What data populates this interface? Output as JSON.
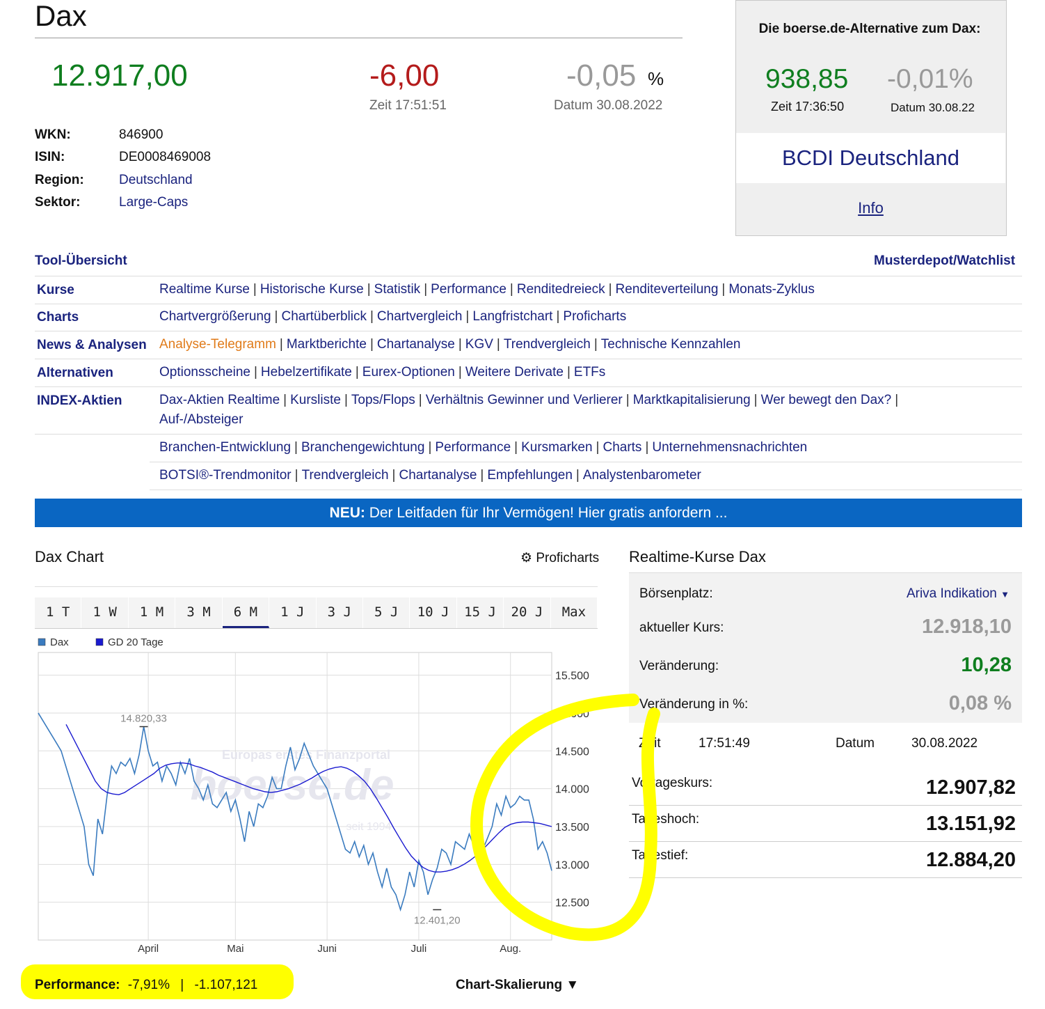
{
  "header": {
    "title": "Dax",
    "price": "12.917,00",
    "change": "-6,00",
    "change_pct": "-0,05",
    "pct_sign": "%",
    "time": "Zeit 17:51:51",
    "date": "Datum 30.08.2022"
  },
  "details": [
    {
      "label": "WKN:",
      "value": "846900"
    },
    {
      "label": "ISIN:",
      "value": "DE0008469008"
    },
    {
      "label": "Region:",
      "value": "Deutschland"
    },
    {
      "label": "Sektor:",
      "value": "Large-Caps"
    }
  ],
  "alt_box": {
    "heading": "Die boerse.de-Alternative zum Dax:",
    "price": "938,85",
    "change_pct": "-0,01%",
    "time": "Zeit 17:36:50",
    "date": "Datum 30.08.22",
    "product": "BCDI Deutschland",
    "info_link": "Info"
  },
  "tools": {
    "heading": "Tool-Übersicht",
    "watchlist": "Musterdepot/Watchlist",
    "rows": [
      {
        "cat": "Kurse",
        "links": [
          "Realtime Kurse",
          "Historische Kurse",
          "Statistik",
          "Performance",
          "Renditedreieck",
          "Renditeverteilung",
          "Monats-Zyklus"
        ]
      },
      {
        "cat": "Charts",
        "links": [
          "Chartvergrößerung",
          "Chartüberblick",
          "Chartvergleich",
          "Langfristchart",
          "Proficharts"
        ]
      },
      {
        "cat": "News & Analysen",
        "links": [
          "Analyse-Telegramm",
          "Marktberichte",
          "Chartanalyse",
          "KGV",
          "Trendvergleich",
          "Technische Kennzahlen"
        ]
      },
      {
        "cat": "Alternativen",
        "links": [
          "Optionsscheine",
          "Hebelzertifikate",
          "Eurex-Optionen",
          "Weitere Derivate",
          "ETFs"
        ]
      },
      {
        "cat": "INDEX-Aktien",
        "links": [
          "Dax-Aktien Realtime",
          "Kursliste",
          "Tops/Flops",
          "Verhältnis Gewinner und Verlierer",
          "Marktkapitalisierung",
          "Wer bewegt den Dax?",
          "Auf-/Absteiger"
        ]
      },
      {
        "cat": "",
        "links": [
          "Branchen-Entwicklung",
          "Branchengewichtung",
          "Performance",
          "Kursmarken",
          "Charts",
          "Unternehmensnachrichten"
        ]
      },
      {
        "cat": "",
        "links": [
          "BOTSI®-Trendmonitor",
          "Trendvergleich",
          "Chartanalyse",
          "Empfehlungen",
          "Analystenbarometer"
        ]
      }
    ]
  },
  "banner": {
    "bold": "NEU:",
    "text": " Der Leitfaden für Ihr Vermögen! Hier gratis anfordern ..."
  },
  "chart_section": {
    "title": "Dax Chart",
    "proficharts": "Proficharts",
    "tabs": [
      "1 T",
      "1 W",
      "1 M",
      "3 M",
      "6 M",
      "1 J",
      "3 J",
      "5 J",
      "10 J",
      "15 J",
      "20 J",
      "Max"
    ],
    "active_tab": "6 M",
    "watermark": "boerse.de",
    "watermark_top": "Europas erstes Finanzportal",
    "watermark_bottom": "seit 1994",
    "performance_label": "Performance:",
    "performance_value": "-7,91%",
    "performance_sep": "|",
    "performance_abs": "-1.107,121",
    "scaling": "Chart-Skalierung ▼"
  },
  "chart_data": {
    "type": "line",
    "legend": [
      {
        "name": "Dax",
        "color": "#3a7bbf"
      },
      {
        "name": "GD 20 Tage",
        "color": "#1a1ad0"
      }
    ],
    "ylim": [
      12000,
      15800
    ],
    "yticks": [
      12500,
      13000,
      13500,
      14000,
      14500,
      15000,
      15500
    ],
    "ytick_labels": [
      "12.500",
      "13.000",
      "13.500",
      "14.000",
      "14.500",
      "15.000",
      "15.500"
    ],
    "xtick_labels": [
      "April",
      "Mai",
      "Juni",
      "Juli",
      "Aug."
    ],
    "xticks_idx": [
      26,
      46,
      68,
      89,
      110
    ],
    "annotations": [
      {
        "label": "14.820,33",
        "index": 23,
        "value": 14820
      },
      {
        "label": "12.401,20",
        "index": 87,
        "value": 12401
      }
    ],
    "series": [
      {
        "name": "Dax",
        "values": [
          15000,
          14900,
          14800,
          14700,
          14600,
          14500,
          14300,
          14100,
          13900,
          13700,
          13500,
          13000,
          12850,
          13600,
          13400,
          13900,
          14300,
          14200,
          14350,
          14300,
          14400,
          14200,
          14450,
          14820,
          14500,
          14300,
          14350,
          14100,
          14300,
          14200,
          14050,
          14350,
          14200,
          14400,
          14100,
          14000,
          13850,
          14050,
          13800,
          13750,
          13850,
          13950,
          13700,
          13850,
          13600,
          13300,
          13700,
          13500,
          13800,
          13750,
          13900,
          14150,
          14000,
          14000,
          14300,
          14550,
          14250,
          14400,
          14600,
          14450,
          14300,
          14200,
          14100,
          14000,
          13800,
          13600,
          13400,
          13200,
          13150,
          13300,
          13100,
          13250,
          13000,
          13150,
          12900,
          12700,
          12950,
          12700,
          12600,
          12401,
          12600,
          12900,
          12700,
          13050,
          12900,
          12600,
          12800,
          12950,
          13200,
          13150,
          13000,
          13300,
          13250,
          13200,
          13400,
          13250,
          13100,
          13200,
          13350,
          13500,
          13800,
          13650,
          13900,
          13750,
          13800,
          13900,
          13850,
          13850,
          13600,
          13200,
          13300,
          13150,
          12917
        ]
      },
      {
        "name": "GD 20 Tage",
        "values": [
          14850,
          14700,
          14550,
          14400,
          14250,
          14100,
          14000,
          13950,
          13930,
          13920,
          13950,
          14000,
          14050,
          14100,
          14150,
          14200,
          14270,
          14310,
          14330,
          14340,
          14340,
          14330,
          14300,
          14280,
          14250,
          14220,
          14180,
          14150,
          14120,
          14090,
          14060,
          14030,
          14000,
          13980,
          13960,
          13950,
          13960,
          13980,
          14000,
          14030,
          14060,
          14100,
          14140,
          14190,
          14230,
          14260,
          14280,
          14290,
          14270,
          14230,
          14170,
          14100,
          14000,
          13880,
          13750,
          13620,
          13480,
          13350,
          13220,
          13110,
          13030,
          12960,
          12920,
          12900,
          12900,
          12910,
          12930,
          12960,
          13000,
          13050,
          13110,
          13180,
          13260,
          13340,
          13420,
          13490,
          13530,
          13550,
          13560,
          13560,
          13550,
          13540,
          13520,
          13500
        ]
      }
    ]
  },
  "realtime": {
    "title": "Realtime-Kurse Dax",
    "boersenplatz_label": "Börsenplatz:",
    "boersenplatz_value": "Ariva Indikation",
    "rows": [
      {
        "label": "aktueller Kurs:",
        "value": "12.918,10",
        "color": "#9a9a9a"
      },
      {
        "label": "Veränderung:",
        "value": "10,28",
        "color": "#0f7e1f"
      },
      {
        "label": "Veränderung in %:",
        "value": "0,08 %",
        "color": "#9a9a9a"
      }
    ],
    "zeit_label": "Zeit",
    "zeit_value": "17:51:49",
    "datum_label": "Datum",
    "datum_value": "30.08.2022",
    "info": [
      {
        "label": "Vortageskurs:",
        "value": "12.907,82"
      },
      {
        "label": "Tageshoch:",
        "value": "13.151,92"
      },
      {
        "label": "Tagestief:",
        "value": "12.884,20"
      }
    ]
  }
}
